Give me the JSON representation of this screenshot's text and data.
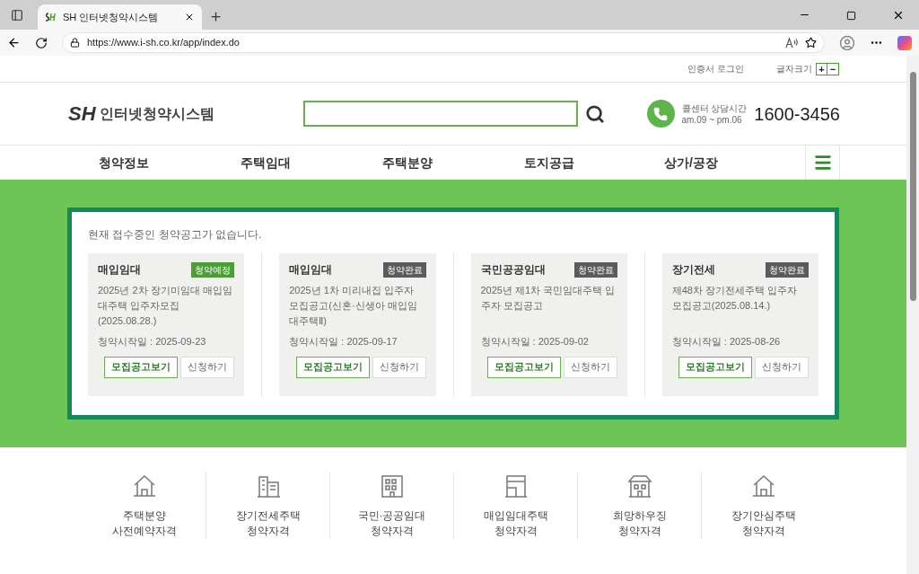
{
  "browser": {
    "tab_title": "SH 인터넷청약시스템",
    "url": "https://www.i-sh.co.kr/app/index.do"
  },
  "util_bar": {
    "login": "인증서 로그인",
    "font_size_label": "글자크기",
    "plus": "+",
    "minus": "−"
  },
  "header": {
    "logo_mark": "SH",
    "logo_text": "인터넷청약시스템",
    "call_label": "콜센터 상담시간",
    "call_hours": "am.09 ~ pm.06",
    "phone": "1600-3456"
  },
  "nav": [
    "청약정보",
    "주택임대",
    "주택분양",
    "토지공급",
    "상가/공장"
  ],
  "notice": "현재 접수중인 청약공고가 없습니다.",
  "cards": [
    {
      "category": "매입임대",
      "badge": {
        "kind": "upcoming",
        "label": "청약예정"
      },
      "title": "2025년 2차 장기미임대 매입임대주택 입주자모집(2025.08.28.)",
      "date": "청약시작일 : 2025-09-23",
      "view": "모집공고보기",
      "apply": "신청하기"
    },
    {
      "category": "매입임대",
      "badge": {
        "kind": "closed",
        "label": "청약완료"
      },
      "title": "2025년 1차 미리내집 입주자 모집공고(신혼·신생아 매입임대주택Ⅱ)",
      "date": "청약시작일 : 2025-09-17",
      "view": "모집공고보기",
      "apply": "신청하기"
    },
    {
      "category": "국민공공임대",
      "badge": {
        "kind": "closed",
        "label": "청약완료"
      },
      "title": "2025년 제1차 국민임대주택 입주자 모집공고",
      "date": "청약시작일 : 2025-09-02",
      "view": "모집공고보기",
      "apply": "신청하기"
    },
    {
      "category": "장기전세",
      "badge": {
        "kind": "closed",
        "label": "청약완료"
      },
      "title": "제48차 장기전세주택 입주자 모집공고(2025.08.14.)",
      "date": "청약시작일 : 2025-08-26",
      "view": "모집공고보기",
      "apply": "신청하기"
    }
  ],
  "qualifications": [
    {
      "kind": "house",
      "line1": "주택분양",
      "line2": "사전예약자격"
    },
    {
      "kind": "tower",
      "line1": "장기전세주택",
      "line2": "청약자격"
    },
    {
      "kind": "apartment",
      "line1": "국민·공공임대",
      "line2": "청약자격"
    },
    {
      "kind": "building",
      "line1": "매입임대주택",
      "line2": "청약자격"
    },
    {
      "kind": "shop",
      "line1": "희망하우징",
      "line2": "청약자격"
    },
    {
      "kind": "house",
      "line1": "장기안심주택",
      "line2": "청약자격"
    }
  ]
}
